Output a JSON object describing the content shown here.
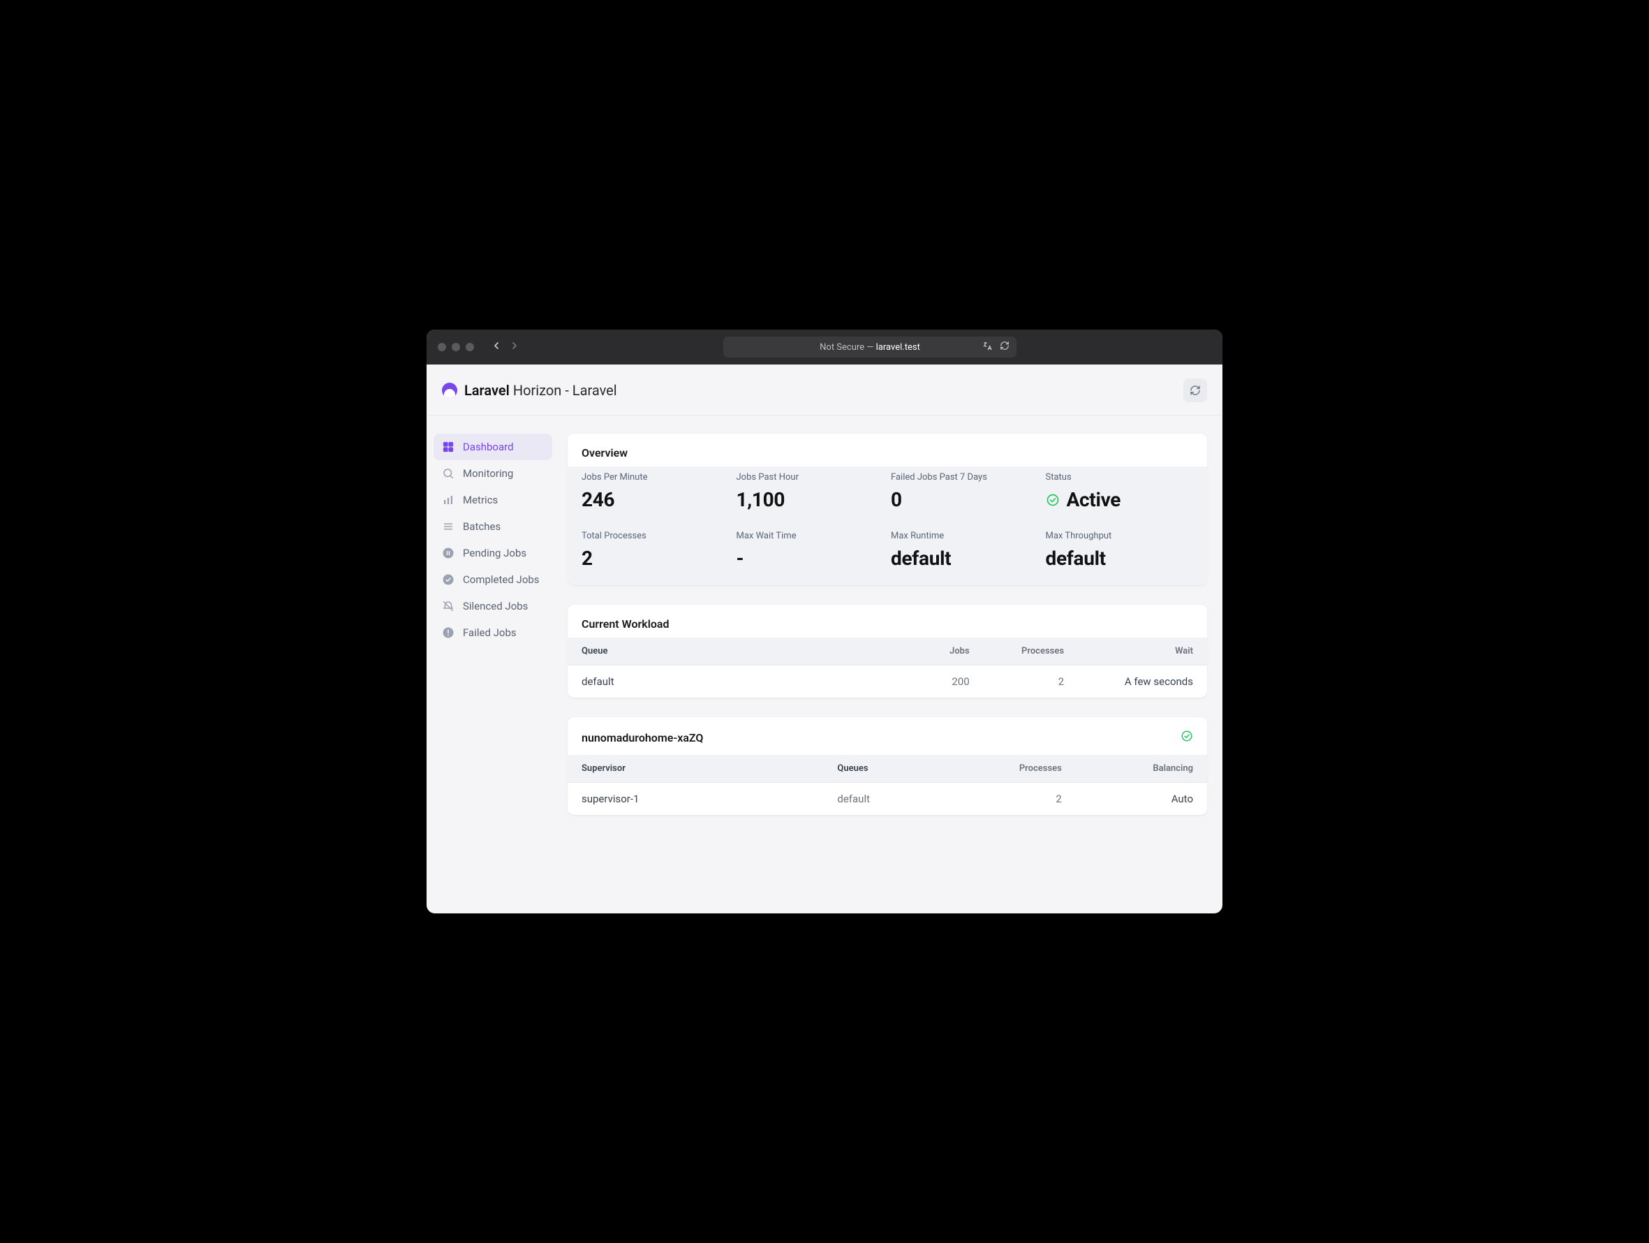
{
  "browser": {
    "address_prefix": "Not Secure — ",
    "address": "laravel.test"
  },
  "header": {
    "brand_primary": "Laravel",
    "brand_secondary": " Horizon - Laravel"
  },
  "sidebar": [
    {
      "label": "Dashboard",
      "active": true,
      "icon": "dashboard"
    },
    {
      "label": "Monitoring",
      "active": false,
      "icon": "search"
    },
    {
      "label": "Metrics",
      "active": false,
      "icon": "bars"
    },
    {
      "label": "Batches",
      "active": false,
      "icon": "list"
    },
    {
      "label": "Pending Jobs",
      "active": false,
      "icon": "pause"
    },
    {
      "label": "Completed Jobs",
      "active": false,
      "icon": "check"
    },
    {
      "label": "Silenced Jobs",
      "active": false,
      "icon": "mute"
    },
    {
      "label": "Failed Jobs",
      "active": false,
      "icon": "alert"
    }
  ],
  "overview": {
    "title": "Overview",
    "stats": [
      {
        "label": "Jobs Per Minute",
        "value": "246"
      },
      {
        "label": "Jobs Past Hour",
        "value": "1,100"
      },
      {
        "label": "Failed Jobs Past 7 Days",
        "value": "0"
      },
      {
        "label": "Status",
        "value": "Active",
        "status": true
      },
      {
        "label": "Total Processes",
        "value": "2"
      },
      {
        "label": "Max Wait Time",
        "value": "-"
      },
      {
        "label": "Max Runtime",
        "value": "default"
      },
      {
        "label": "Max Throughput",
        "value": "default"
      }
    ]
  },
  "workload": {
    "title": "Current Workload",
    "columns": [
      "Queue",
      "Jobs",
      "Processes",
      "Wait"
    ],
    "rows": [
      {
        "queue": "default",
        "jobs": "200",
        "processes": "2",
        "wait": "A few seconds"
      }
    ]
  },
  "host": {
    "name": "nunomadurohome-xaZQ",
    "status_ok": true,
    "columns": [
      "Supervisor",
      "Queues",
      "Processes",
      "Balancing"
    ],
    "rows": [
      {
        "supervisor": "supervisor-1",
        "queues": "default",
        "processes": "2",
        "balancing": "Auto"
      }
    ]
  }
}
